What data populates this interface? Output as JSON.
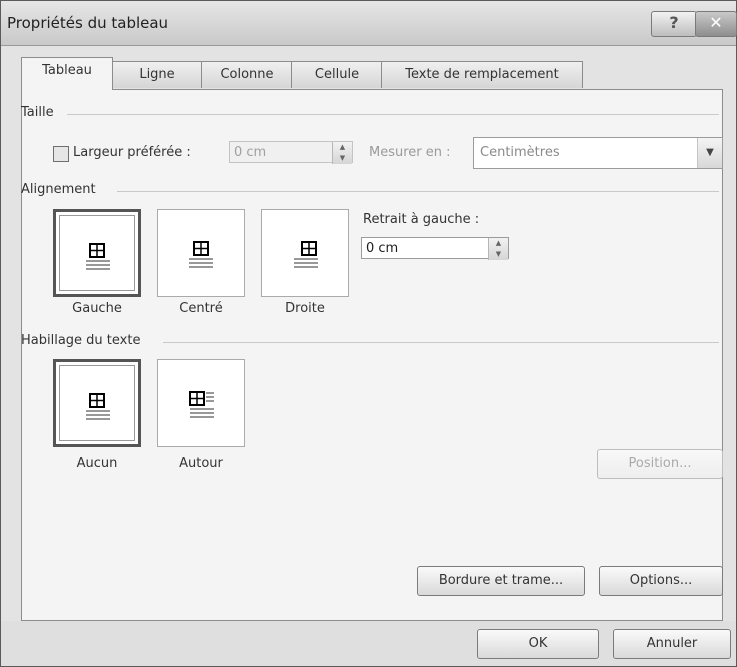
{
  "window": {
    "title": "Propriétés du tableau",
    "help_glyph": "?",
    "close_glyph": "✕"
  },
  "tabs": [
    {
      "label": "Tableau"
    },
    {
      "label": "Ligne"
    },
    {
      "label": "Colonne"
    },
    {
      "label": "Cellule"
    },
    {
      "label": "Texte de remplacement"
    }
  ],
  "taille": {
    "section": "Taille",
    "largeur_label": "Largeur préférée :",
    "largeur_value": "0 cm",
    "mesurer_label": "Mesurer en :",
    "mesurer_value": "Centimètres"
  },
  "alignement": {
    "section": "Alignement",
    "options": [
      {
        "label": "Gauche"
      },
      {
        "label": "Centré"
      },
      {
        "label": "Droite"
      }
    ],
    "retrait_label": "Retrait à gauche :",
    "retrait_value": "0 cm"
  },
  "habillage": {
    "section": "Habillage du texte",
    "options": [
      {
        "label": "Aucun"
      },
      {
        "label": "Autour"
      }
    ],
    "position_button": "Position..."
  },
  "buttons": {
    "bordure": "Bordure et trame...",
    "options": "Options...",
    "ok": "OK",
    "annuler": "Annuler"
  },
  "icons": {
    "spin_up": "▲",
    "spin_down": "▼",
    "dropdown": "▼"
  }
}
